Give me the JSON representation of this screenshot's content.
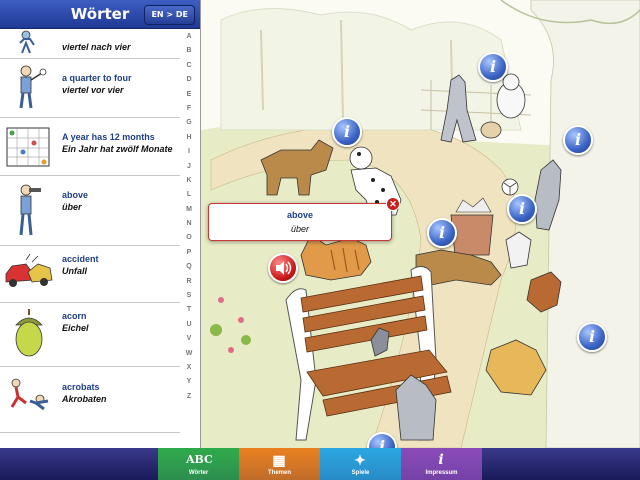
{
  "header": {
    "title": "Wörter",
    "lang_button": "EN > DE"
  },
  "words": [
    {
      "en": "",
      "de": "viertel nach vier",
      "icon": "boy-clock-icon"
    },
    {
      "en": "a quarter to four",
      "de": "viertel vor vier",
      "icon": "boy-clock-icon"
    },
    {
      "en": "A year has 12 months",
      "de": "Ein Jahr hat zwölf Monate",
      "icon": "calendar-icon"
    },
    {
      "en": "above",
      "de": "über",
      "icon": "boy-binoculars-icon"
    },
    {
      "en": "accident",
      "de": "Unfall",
      "icon": "car-crash-icon"
    },
    {
      "en": "acorn",
      "de": "Eichel",
      "icon": "acorn-icon"
    },
    {
      "en": "acrobats",
      "de": "Akrobaten",
      "icon": "acrobats-icon"
    }
  ],
  "alphabet": [
    "A",
    "B",
    "C",
    "D",
    "E",
    "F",
    "G",
    "H",
    "I",
    "J",
    "K",
    "L",
    "M",
    "N",
    "O",
    "P",
    "Q",
    "R",
    "S",
    "T",
    "U",
    "V",
    "W",
    "X",
    "Y",
    "Z"
  ],
  "popup": {
    "en": "above",
    "de": "über"
  },
  "info_symbol": "i",
  "tabs": [
    {
      "label": "Wörter",
      "icon": "abc-icon",
      "glyph": "ABC",
      "color": "#2faa4a"
    },
    {
      "label": "Themen",
      "icon": "grid-icon",
      "glyph": "▦",
      "color": "#e8801e"
    },
    {
      "label": "Spiele",
      "icon": "puzzle-icon",
      "glyph": "✦",
      "color": "#2aa6e0"
    },
    {
      "label": "Impressum",
      "icon": "info-icon",
      "glyph": "i",
      "color": "#8a4ab8"
    }
  ]
}
